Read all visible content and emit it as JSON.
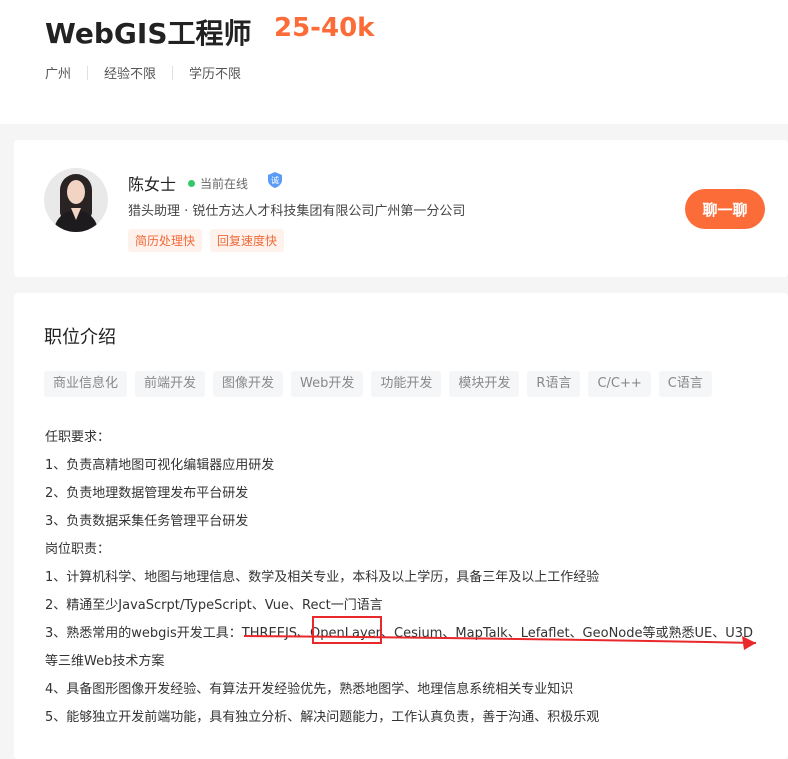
{
  "header": {
    "title": "WebGIS工程师",
    "salary": "25-40k",
    "meta": [
      "广州",
      "经验不限",
      "学历不限"
    ]
  },
  "recruiter": {
    "name": "陈女士",
    "status": "当前在线",
    "verify_badge": "诚",
    "company": "猎头助理 · 锐仕方达人才科技集团有限公司广州第一分公司",
    "tags": [
      "简历处理快",
      "回复速度快"
    ],
    "chat_button": "聊一聊"
  },
  "description": {
    "title": "职位介绍",
    "skills": [
      "商业信息化",
      "前端开发",
      "图像开发",
      "Web开发",
      "功能开发",
      "模块开发",
      "R语言",
      "C/C++",
      "C语言"
    ],
    "lines": [
      "任职要求：",
      "1、负责高精地图可视化编辑器应用研发",
      "2、负责地理数据管理发布平台研发",
      "3、负责数据采集任务管理平台研发",
      "岗位职责：",
      "1、计算机科学、地图与地理信息、数学及相关专业，本科及以上学历，具备三年及以上工作经验",
      "2、精通至少JavaScrpt/TypeScript、Vue、Rect一门语言",
      "3、熟悉常用的webgis开发工具：THREEJS、OpenLayer、Cesium、MapTalk、Lefaflet、GeoNode等或熟悉UE、U3D",
      "等三维Web技术方案",
      "4、具备图形图像开发经验、有算法开发经验优先，熟悉地图学、地理信息系统相关专业知识",
      "5、能够独立开发前端功能，具有独立分析、解决问题能力，工作认真负责，善于沟通、积极乐观"
    ]
  },
  "colors": {
    "accent": "#fc6c38",
    "online": "#35c86a",
    "annotation": "#e8282b"
  }
}
